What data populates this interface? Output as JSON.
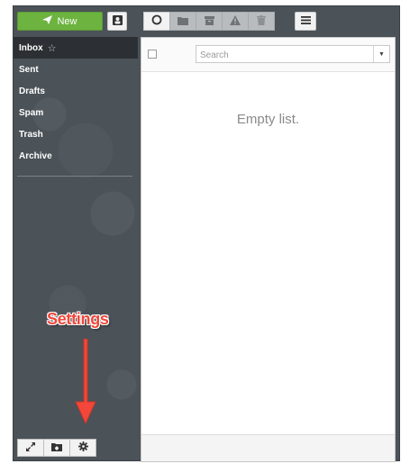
{
  "toolbar": {
    "new_label": "New",
    "new_icon": "paper-plane-icon",
    "contacts_icon": "contacts-icon",
    "buttons": [
      {
        "icon": "circle-refresh-icon",
        "state": "active"
      },
      {
        "icon": "folder-icon",
        "state": "disabled"
      },
      {
        "icon": "archive-box-icon",
        "state": "disabled"
      },
      {
        "icon": "warning-spam-icon",
        "state": "disabled"
      },
      {
        "icon": "trash-icon",
        "state": "disabled"
      }
    ],
    "menu_icon": "hamburger-menu-icon"
  },
  "sidebar": {
    "folders": [
      {
        "label": "Inbox",
        "selected": true,
        "starred": true
      },
      {
        "label": "Sent"
      },
      {
        "label": "Drafts"
      },
      {
        "label": "Spam"
      },
      {
        "label": "Trash"
      },
      {
        "label": "Archive"
      }
    ],
    "bottom_buttons": [
      "expand-icon",
      "folder-icon",
      "gear-icon"
    ]
  },
  "message_list": {
    "search_placeholder": "Search",
    "empty_text": "Empty list."
  },
  "annotation": {
    "label": "Settings",
    "color": "#f2473a"
  },
  "colors": {
    "new_button": "#6cb33f",
    "sidebar_bg": "#4b5258",
    "selected_folder": "#2c3034"
  }
}
